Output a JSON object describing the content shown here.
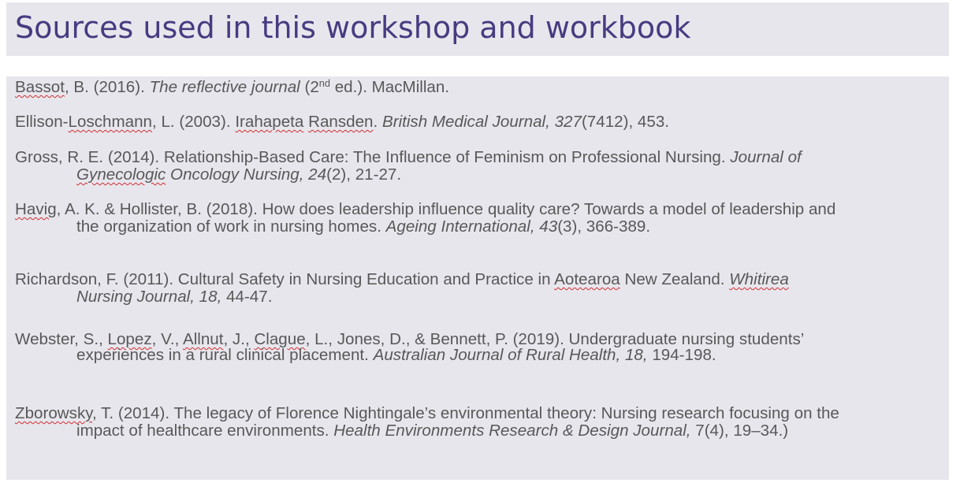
{
  "title": "Sources used in this workshop and workbook",
  "refs": {
    "bassot": {
      "author": "Bassot",
      "a": ", B. (2016). ",
      "book": "The reflective journal",
      "b": " (2",
      "sup": "nd",
      "c": " ed.). MacMillan."
    },
    "ellison": {
      "a": "Ellison-",
      "author": "Loschmann",
      "b": ", L. (2003). ",
      "t1": "Irahapeta",
      "sp": " ",
      "t2": "Ransden",
      "c": ". ",
      "journal": "British Medical Journal, 327",
      "d": "(7412), 453."
    },
    "gross": {
      "a": "Gross, R. E. (2014).  Relationship-Based Care: The Influence of Feminism on Professional Nursing. ",
      "journal1": "Journal of",
      "journal2a": "Gynecologic",
      "journal2b": " Oncology Nursing, 24",
      "d": "(2), 21-27."
    },
    "havig": {
      "author": "Havig",
      "a": ", A. K. & Hollister, B. (2018). How does leadership influence quality care? Towards a model of leadership and",
      "b": "the organization of work in nursing homes. ",
      "journal": "Ageing International, 43",
      "d": "(3), 366-389."
    },
    "richardson": {
      "a": "Richardson, F. (2011).  Cultural Safety in Nursing Education and Practice in ",
      "place": "Aotearoa",
      "b": " New Zealand. ",
      "journal1": "Whitirea",
      "journal2": "Nursing Journal, 18,",
      "d": " 44-47."
    },
    "webster": {
      "a": "Webster, S., ",
      "n1": "Lopez",
      "b": ", V., ",
      "n2": "Allnut",
      "c": ", J., ",
      "n3": "Clague",
      "d": ", L., Jones, D., & Bennett, P. (2019). Undergraduate nursing students’",
      "e": "experiences in a rural clinical placement. ",
      "journal": "Australian Journal of Rural Health, 18,",
      "f": " 194-198."
    },
    "zborowsky": {
      "author": "Zborowsky",
      "a": ", T. (2014). The legacy of Florence Nightingale’s environmental theory: Nursing research focusing on the",
      "b": "impact of healthcare environments. ",
      "journal": "Health Environments Research & Design Journal, ",
      "d": "7(4), 19–34.)"
    }
  }
}
